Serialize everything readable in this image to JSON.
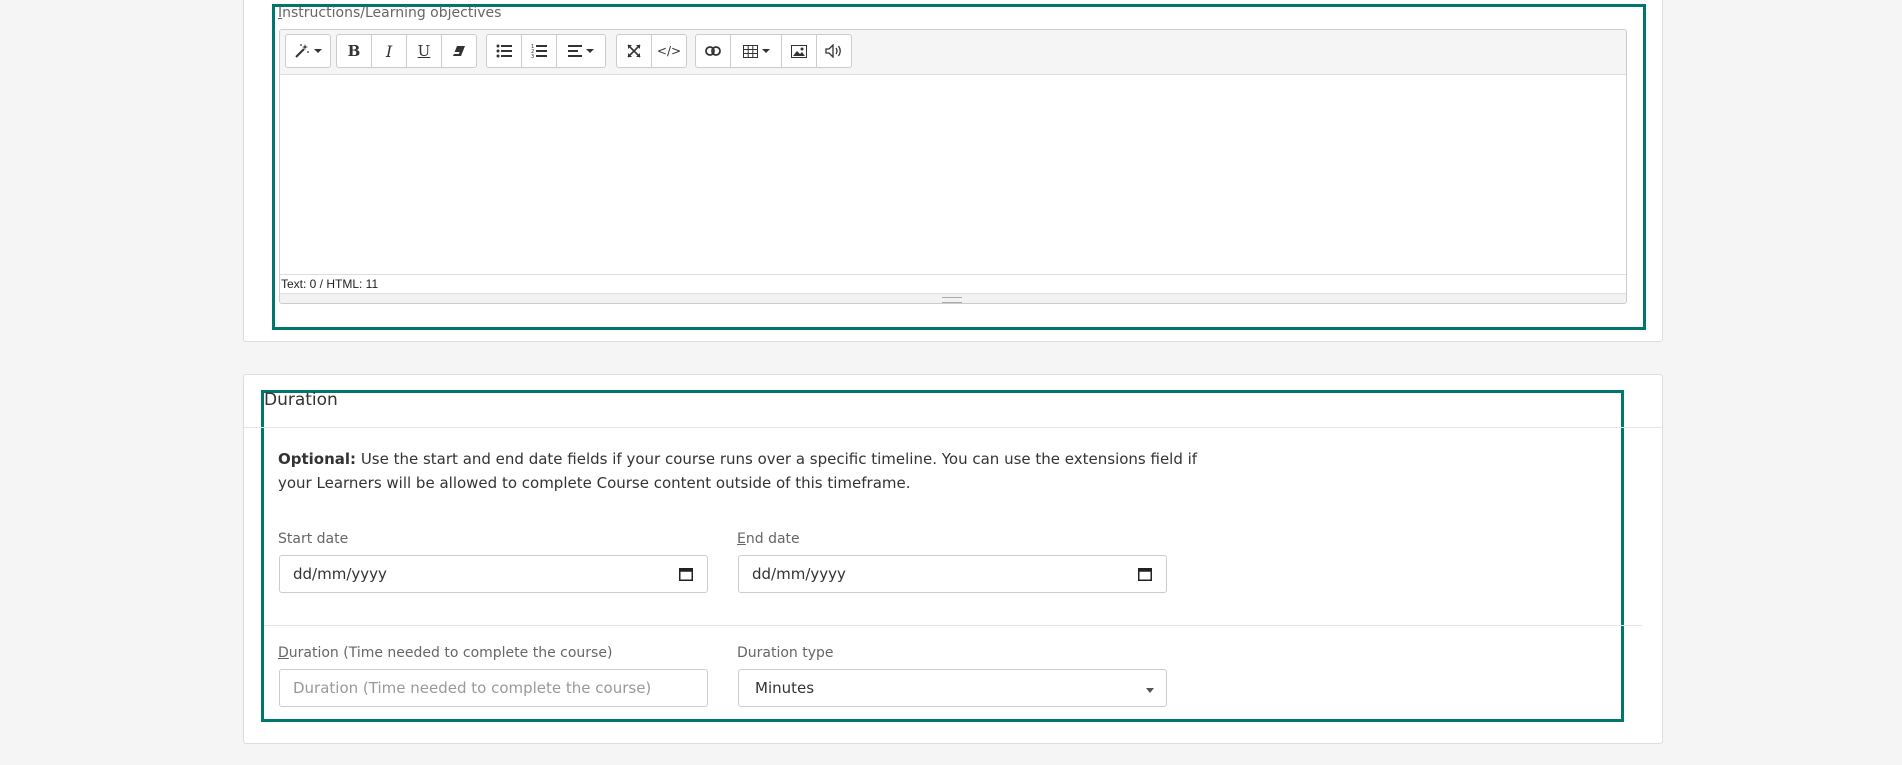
{
  "instructions": {
    "label_first_letter": "I",
    "label_rest": "nstructions/Learning objectives",
    "status_text": "Text: 0 / HTML: 11",
    "toolbar": {
      "style": "magic-wand-icon",
      "bold": "bold-icon",
      "italic": "italic-icon",
      "underline": "underline-icon",
      "clear": "eraser-icon",
      "ul": "unordered-list-icon",
      "ol": "ordered-list-icon",
      "align": "align-icon",
      "fullscreen": "expand-icon",
      "code": "code-view-icon",
      "link": "link-icon",
      "table": "table-icon",
      "image": "image-icon",
      "audio": "audio-icon"
    }
  },
  "duration": {
    "title": "Duration",
    "help_bold": "Optional:",
    "help_text": " Use the start and end date fields if your course runs over a specific timeline. You can use the extensions field if your Learners will be allowed to complete Course content outside of this timeframe.",
    "start_date": {
      "label": "Start date",
      "value": "dd/mm/yyyy"
    },
    "end_date": {
      "label_first_letter": "E",
      "label_rest": "nd date",
      "value": "dd/mm/yyyy"
    },
    "duration_field": {
      "label_first_letter": "D",
      "label_rest": "uration (Time needed to complete the course)",
      "placeholder": "Duration (Time needed to complete the course)"
    },
    "duration_type": {
      "label": "Duration type",
      "value": "Minutes"
    }
  },
  "colors": {
    "focus_outline": "#00766c",
    "card_border": "#dddddd",
    "page_bg": "#f5f5f5"
  }
}
